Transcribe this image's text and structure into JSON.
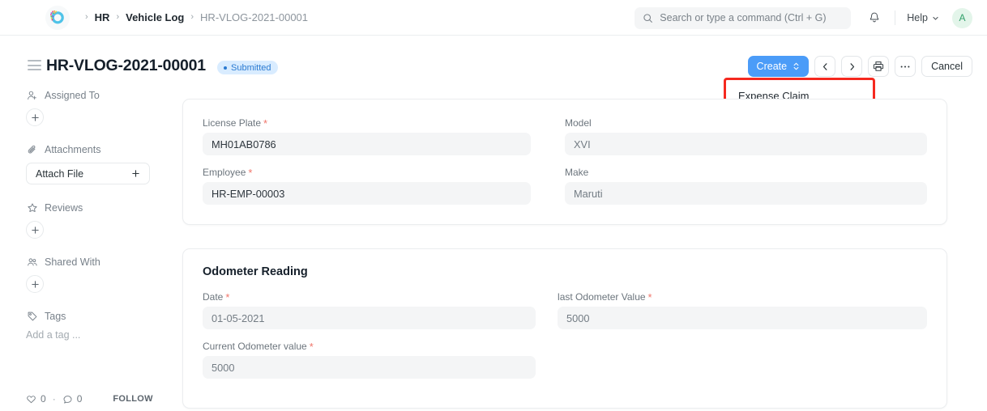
{
  "navbar": {
    "logo_name": "frappe-logo",
    "breadcrumb": [
      {
        "label": "HR",
        "last": false
      },
      {
        "label": "Vehicle Log",
        "last": false
      },
      {
        "label": "HR-VLOG-2021-00001",
        "last": true
      }
    ],
    "search_placeholder": "Search or type a command (Ctrl + G)",
    "search_value": "",
    "notification_icon": "bell-icon",
    "help_label": "Help",
    "avatar_initial": "A"
  },
  "title_bar": {
    "menu_icon": "hamburger-icon",
    "doc_title": "HR-VLOG-2021-00001",
    "status": "Submitted",
    "status_color": "#2b7ad1",
    "status_bg": "#d9ecff",
    "create_label": "Create",
    "prev_icon": "chevron-left-icon",
    "next_icon": "chevron-right-icon",
    "print_icon": "printer-icon",
    "more_icon": "ellipsis-icon",
    "cancel_label": "Cancel",
    "primary_color": "#4b9cf8"
  },
  "dropdown": {
    "highlight_color": "#f5291f",
    "items": [
      {
        "label": "Expense Claim"
      }
    ]
  },
  "sidebar": {
    "sections": [
      {
        "icon": "assign-user-icon",
        "label": "Assigned To",
        "control": "plus"
      },
      {
        "icon": "paperclip-icon",
        "label": "Attachments",
        "control": "attach",
        "attach_label": "Attach File"
      },
      {
        "icon": "star-icon",
        "label": "Reviews",
        "control": "plus"
      },
      {
        "icon": "shared-users-icon",
        "label": "Shared With",
        "control": "plus"
      },
      {
        "icon": "tag-icon",
        "label": "Tags",
        "control": "tag",
        "tag_placeholder": "Add a tag ..."
      }
    ],
    "footer": {
      "like_icon": "heart-icon",
      "like_count": "0",
      "separator": "·",
      "comment_icon": "comment-icon",
      "comment_count": "0",
      "follow_label": "FOLLOW"
    }
  },
  "form": {
    "card1": {
      "fields": [
        {
          "label": "License Plate",
          "required": true,
          "value": "MH01AB0786",
          "muted": false
        },
        {
          "label": "Employee",
          "required": true,
          "value": "HR-EMP-00003",
          "muted": false
        },
        {
          "label": "Model",
          "required": false,
          "value": "XVI",
          "muted": true
        },
        {
          "label": "Make",
          "required": false,
          "value": "Maruti",
          "muted": true
        }
      ]
    },
    "card2": {
      "title": "Odometer Reading",
      "fields": [
        {
          "label": "Date",
          "required": true,
          "value": "01-05-2021",
          "muted": true
        },
        {
          "label": "last Odometer Value",
          "required": true,
          "value": "5000",
          "muted": true
        },
        {
          "label": "Current Odometer value",
          "required": true,
          "value": "5000",
          "muted": true
        }
      ]
    }
  }
}
